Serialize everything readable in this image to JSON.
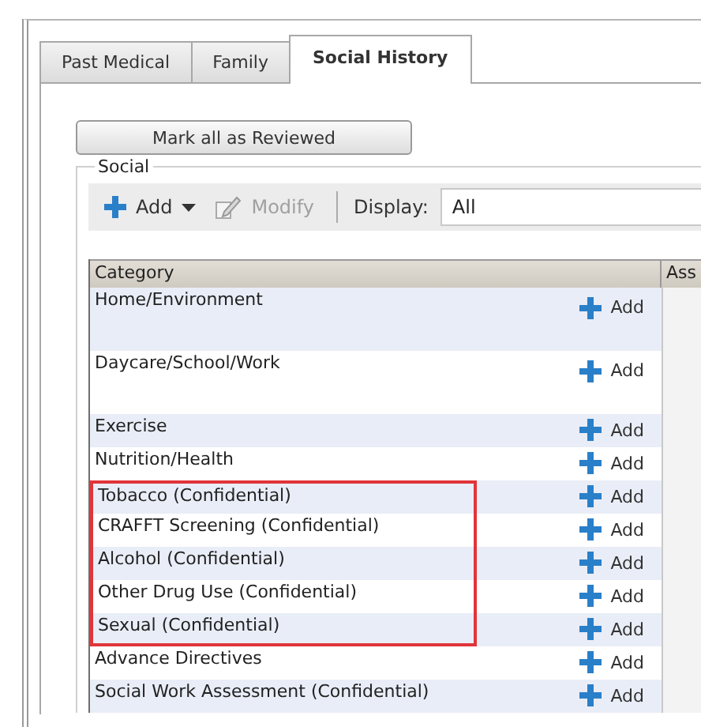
{
  "tabs": [
    {
      "label": "Past Medical",
      "selected": false
    },
    {
      "label": "Family",
      "selected": false
    },
    {
      "label": "Social History",
      "selected": true
    }
  ],
  "review_button": "Mark all as Reviewed",
  "group": {
    "title": "Social",
    "toolbar": {
      "add": "Add",
      "modify": {
        "label": "Modify",
        "disabled": true
      },
      "display_label": "Display:",
      "display_value": "All"
    },
    "table": {
      "columns": [
        "Category",
        "Ass"
      ],
      "rows": [
        {
          "category": "Home/Environment",
          "action": "Add",
          "kind": "tall",
          "highlighted": false
        },
        {
          "category": "Daycare/School/Work",
          "action": "Add",
          "kind": "tall",
          "highlighted": false
        },
        {
          "category": "Exercise",
          "action": "Add",
          "kind": "single",
          "highlighted": false
        },
        {
          "category": "Nutrition/Health",
          "action": "Add",
          "kind": "single",
          "highlighted": false
        },
        {
          "category": "Tobacco (Confidential)",
          "action": "Add",
          "kind": "single",
          "highlighted": true
        },
        {
          "category": "CRAFFT Screening (Confidential)",
          "action": "Add",
          "kind": "single",
          "highlighted": true
        },
        {
          "category": "Alcohol (Confidential)",
          "action": "Add",
          "kind": "single",
          "highlighted": true
        },
        {
          "category": "Other Drug Use (Confidential)",
          "action": "Add",
          "kind": "single",
          "highlighted": true
        },
        {
          "category": "Sexual (Confidential)",
          "action": "Add",
          "kind": "single",
          "highlighted": true
        },
        {
          "category": "Advance Directives",
          "action": "Add",
          "kind": "single",
          "highlighted": false
        },
        {
          "category": "Social Work Assessment (Confidential)",
          "action": "Add",
          "kind": "single",
          "highlighted": false
        }
      ]
    }
  }
}
